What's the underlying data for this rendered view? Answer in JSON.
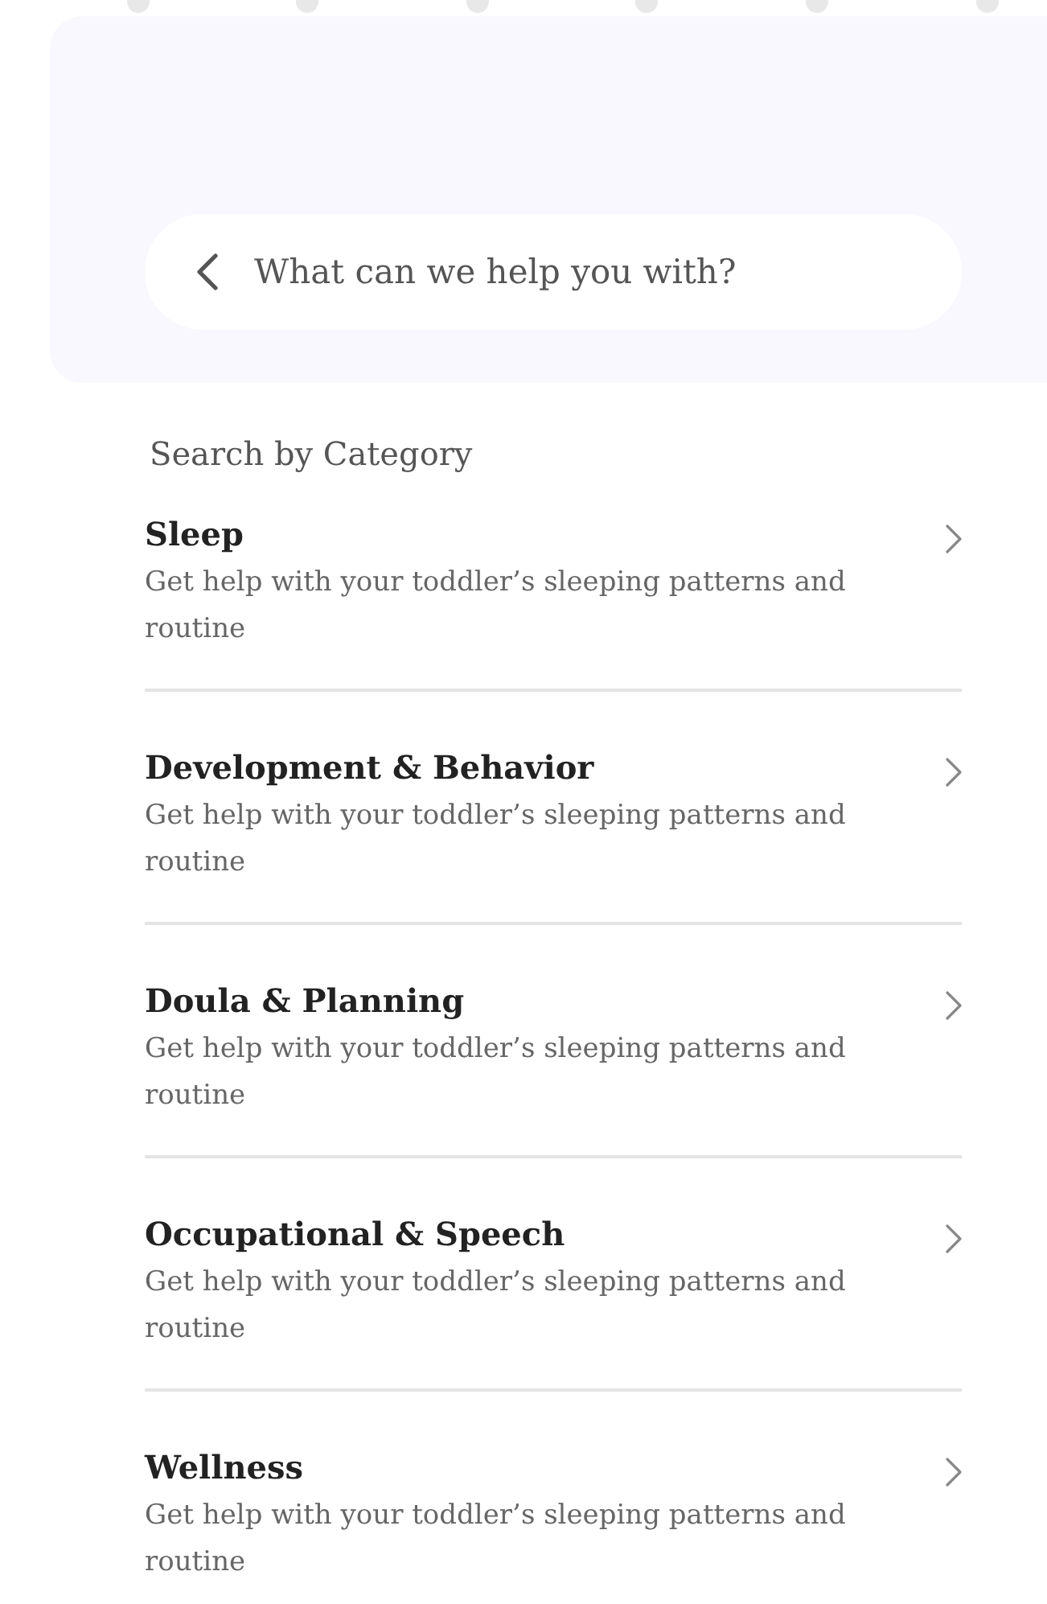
{
  "search": {
    "placeholder": "What can we help you with?"
  },
  "section_title": "Search by Category",
  "categories": [
    {
      "title": "Sleep",
      "description": "Get help with your toddler’s sleeping patterns and routine"
    },
    {
      "title": "Development & Behavior",
      "description": "Get help with your toddler’s sleeping patterns and routine"
    },
    {
      "title": "Doula & Planning",
      "description": "Get help with your toddler’s sleeping patterns and routine"
    },
    {
      "title": "Occupational & Speech",
      "description": "Get help with your toddler’s sleeping patterns and routine"
    },
    {
      "title": "Wellness",
      "description": "Get help with your toddler’s sleeping patterns and routine"
    }
  ]
}
